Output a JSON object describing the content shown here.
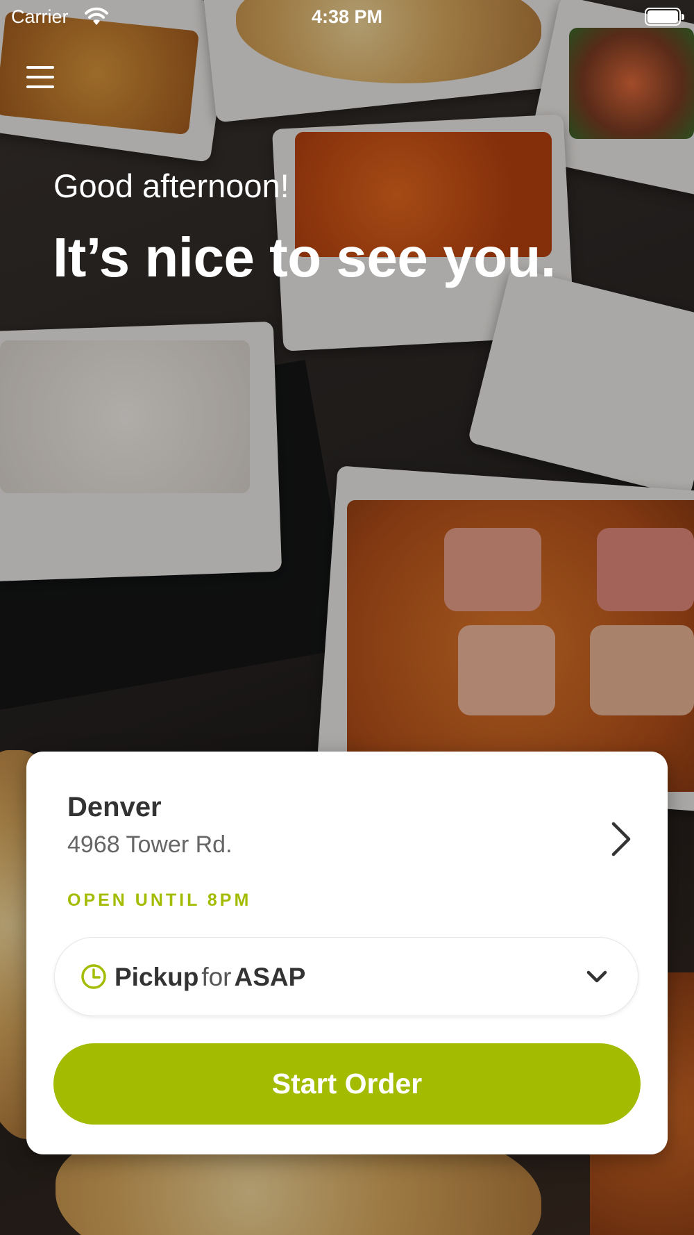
{
  "status_bar": {
    "carrier": "Carrier",
    "time": "4:38 PM"
  },
  "header": {
    "menu_icon": "hamburger-menu-icon",
    "greeting": "Good afternoon!",
    "headline": "It’s nice to see you."
  },
  "location": {
    "city": "Denver",
    "address": "4968 Tower Rd.",
    "hours": "OPEN UNTIL 8PM",
    "chevron_icon": "chevron-right-icon"
  },
  "order_mode": {
    "icon": "clock-icon",
    "mode": "Pickup",
    "connector": "for",
    "time": "ASAP",
    "dropdown_icon": "chevron-down-icon"
  },
  "cta": {
    "label": "Start Order"
  },
  "colors": {
    "accent": "#a3bb00",
    "text_dark": "#333333",
    "text_muted": "#666666",
    "card_bg": "#ffffff"
  }
}
